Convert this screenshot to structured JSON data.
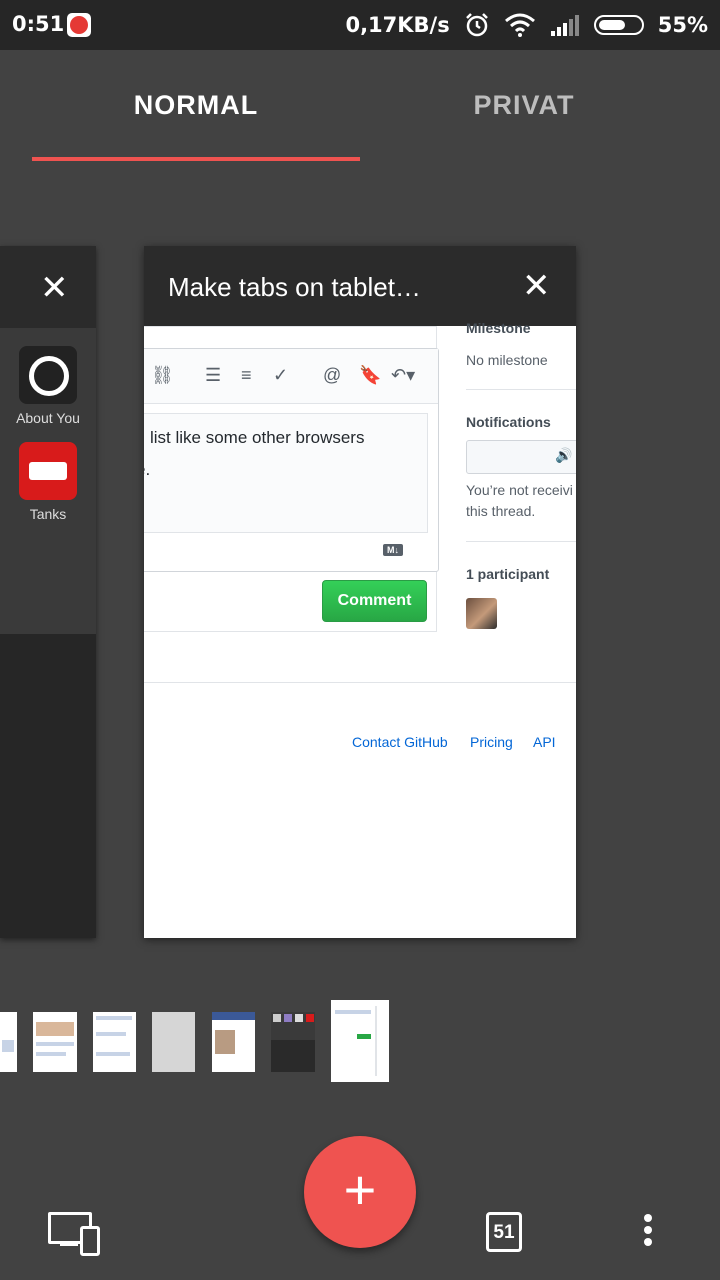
{
  "status_bar": {
    "time": "0:51",
    "network_speed": "0,17KB/s",
    "battery": "55%"
  },
  "tabs": {
    "normal": "NORMAL",
    "private": "PRIVAT",
    "active": "NORMAL",
    "indicator_color": "#ef5350"
  },
  "left_card": {
    "apps": [
      {
        "label": "About You",
        "icon": "about-you-icon"
      },
      {
        "label": "Tanks",
        "icon": "tanks-icon"
      }
    ]
  },
  "main_card": {
    "title": "Make tabs on tablet…",
    "editor_text_line1": "list like some other browsers",
    "editor_text_line2": "e.",
    "markdown_badge": "M↓",
    "comment_button": "Comment",
    "sidebar": {
      "milestone_heading": "Milestone",
      "milestone_value": "No milestone",
      "notifications_heading": "Notifications",
      "notifications_text_line1": "You’re not receivi",
      "notifications_text_line2": "this thread.",
      "participants": "1 participant"
    },
    "footer_links": [
      "Contact GitHub",
      "Pricing",
      "API"
    ]
  },
  "bottom": {
    "fab": "+",
    "tab_count": "51"
  }
}
